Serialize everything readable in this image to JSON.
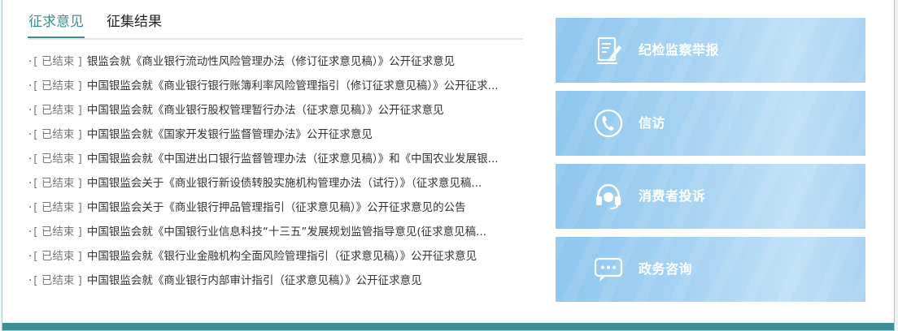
{
  "tabs": {
    "active": "征求意见",
    "inactive": "征集结果"
  },
  "notices": [
    {
      "bullet": "·",
      "status": "[ 已结束 ]",
      "title": "银监会就《商业银行流动性风险管理办法（修订征求意见稿）》公开征求意见"
    },
    {
      "bullet": "·",
      "status": "[ 已结束 ]",
      "title": "中国银监会就《商业银行银行账簿利率风险管理指引（修订征求意见稿）》公开征求..."
    },
    {
      "bullet": "·",
      "status": "[ 已结束 ]",
      "title": "中国银监会就《商业银行股权管理暂行办法（征求意见稿）》公开征求意见"
    },
    {
      "bullet": "·",
      "status": "[ 已结束 ]",
      "title": "中国银监会就《国家开发银行监督管理办法》公开征求意见"
    },
    {
      "bullet": "·",
      "status": "[ 已结束 ]",
      "title": "中国银监会就《中国进出口银行监督管理办法（征求意见稿）》和《中国农业发展银..."
    },
    {
      "bullet": "·",
      "status": "[ 已结束 ]",
      "title": "中国银监会关于《商业银行新设债转股实施机构管理办法（试行）》（征求意见稿..."
    },
    {
      "bullet": "·",
      "status": "[ 已结束 ]",
      "title": "中国银监会关于《商业银行押品管理指引（征求意见稿）》公开征求意见的公告"
    },
    {
      "bullet": "·",
      "status": "[ 已结束 ]",
      "title": "中国银监会就《中国银行业信息科技“十三五”发展规划监管指导意见(征求意见稿..."
    },
    {
      "bullet": "·",
      "status": "[ 已结束 ]",
      "title": "中国银监会就《银行业金融机构全面风险管理指引（征求意见稿）》公开征求意见"
    },
    {
      "bullet": "·",
      "status": "[ 已结束 ]",
      "title": "中国银监会就《商业银行内部审计指引（征求意见稿）》公开征求意见"
    }
  ],
  "tiles": [
    {
      "label": "纪检监察举报",
      "icon": "report-form-icon"
    },
    {
      "label": "信访",
      "icon": "phone-icon"
    },
    {
      "label": "消费者投诉",
      "icon": "headset-icon"
    },
    {
      "label": "政务咨询",
      "icon": "chat-bubble-icon"
    }
  ],
  "colors": {
    "accent": "#3d8d8f",
    "bottom_bar": "#3f9094",
    "tile_blue": "#a7d3f2"
  }
}
